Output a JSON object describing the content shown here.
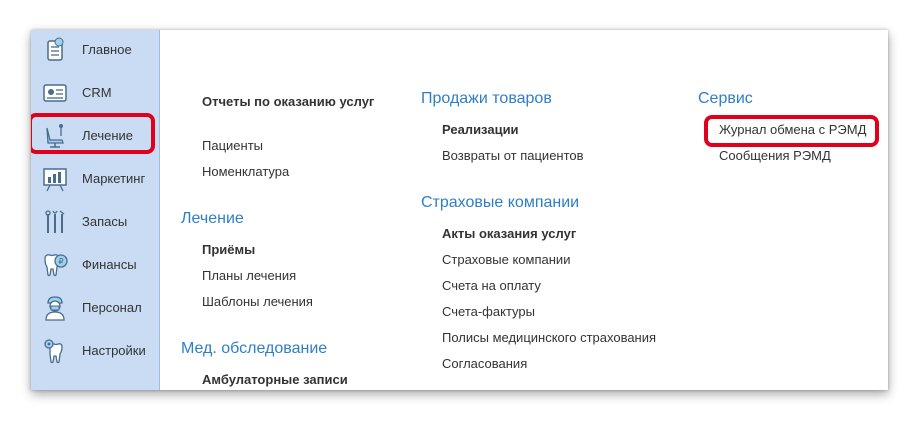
{
  "sidebar": {
    "items": [
      {
        "label": "Главное",
        "icon": "home-list-icon"
      },
      {
        "label": "CRM",
        "icon": "crm-card-icon"
      },
      {
        "label": "Лечение",
        "icon": "dental-chair-icon"
      },
      {
        "label": "Маркетинг",
        "icon": "chart-board-icon"
      },
      {
        "label": "Запасы",
        "icon": "dental-tools-icon"
      },
      {
        "label": "Финансы",
        "icon": "tooth-coin-icon"
      },
      {
        "label": "Персонал",
        "icon": "doctor-icon"
      },
      {
        "label": "Настройки",
        "icon": "tooth-gear-icon"
      }
    ]
  },
  "content": {
    "col1": {
      "top_heading_bold": "Отчеты по оказанию услуг",
      "top_items": [
        "Пациенты",
        "Номенклатура"
      ],
      "lechenie": {
        "heading": "Лечение",
        "bold_item": "Приёмы",
        "items": [
          "Планы лечения",
          "Шаблоны лечения"
        ]
      },
      "med": {
        "heading": "Мед. обследование",
        "bold_item": "Амбулаторные записи"
      }
    },
    "col2": {
      "sales": {
        "heading": "Продажи товаров",
        "bold_item": "Реализации",
        "items": [
          "Возвраты от пациентов"
        ]
      },
      "insurance": {
        "heading": "Страховые компании",
        "bold_item": "Акты оказания услуг",
        "items": [
          "Страховые компании",
          "Счета на оплату",
          "Счета-фактуры",
          "Полисы медицинского страхования",
          "Согласования"
        ]
      }
    },
    "col3": {
      "service": {
        "heading": "Сервис",
        "items": [
          "Журнал обмена с РЭМД",
          "Сообщения РЭМД"
        ]
      }
    }
  },
  "colors": {
    "highlight": "#e0001b",
    "heading": "#2e7fc6",
    "sidebar_bg": "#c9dcf3"
  }
}
